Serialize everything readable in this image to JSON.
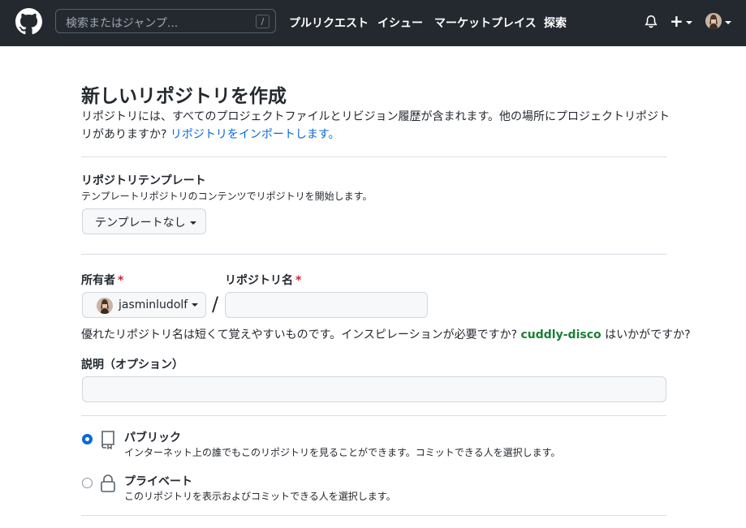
{
  "header": {
    "search_placeholder": "検索またはジャンプ...",
    "search_shortcut": "/",
    "nav": [
      "プルリクエスト",
      "イシュー",
      "マーケットプレイス",
      "探索"
    ],
    "create_label": "+"
  },
  "page": {
    "title": "新しいリポジトリを作成",
    "intro_text": "リポジトリには、すべてのプロジェクトファイルとリビジョン履歴が含まれます。他の場所にプロジェクトリポジトリがありますか? ",
    "import_link": "リポジトリをインポートします。"
  },
  "template": {
    "label": "リポジトリテンプレート",
    "description": "テンプレートリポジトリのコンテンツでリポジトリを開始します。",
    "button_label": "テンプレートなし"
  },
  "owner": {
    "label": "所有者",
    "required_mark": "*",
    "value": "jasminludolf"
  },
  "repo_name": {
    "label": "リポジトリ名",
    "required_mark": "*",
    "value": "",
    "separator": "/"
  },
  "hint": {
    "prefix": "優れたリポジトリ名は短くて覚えやすいものです。インスピレーションが必要ですか? ",
    "suggestion": "cuddly-disco",
    "suffix": " はいかがですか?"
  },
  "description_field": {
    "label": "説明（オプション）",
    "value": ""
  },
  "visibility": {
    "selected": "public",
    "public_title": "パブリック",
    "public_desc": "インターネット上の誰でもこのリポジトリを見ることができます。コミットできる人を選択します。",
    "private_title": "プライベート",
    "private_desc": "このリポジトリを表示およびコミットできる人を選択します。"
  },
  "colors": {
    "header_bg": "#24292f",
    "link": "#0969da",
    "required": "#cf222e",
    "suggestion": "#1a7f37"
  }
}
